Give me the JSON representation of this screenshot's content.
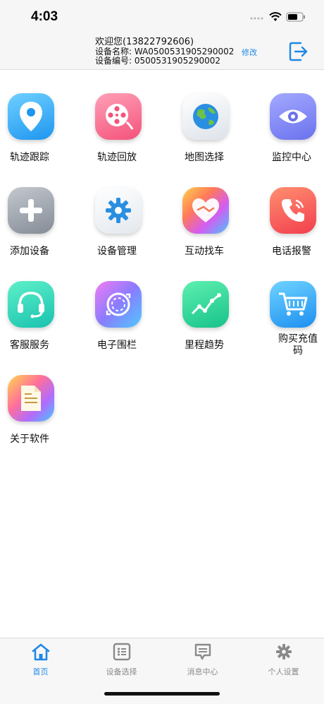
{
  "status": {
    "time": "4:03"
  },
  "header": {
    "welcome": "欢迎您(13822792606)",
    "device_name": "设备名称: WA0500531905290002",
    "device_no": "设备编号: 0500531905290002",
    "edit_label": "修改"
  },
  "tiles": [
    {
      "label": "轨迹跟踪",
      "icon": "location-pin-icon"
    },
    {
      "label": "轨迹回放",
      "icon": "film-reel-icon"
    },
    {
      "label": "地图选择",
      "icon": "globe-icon"
    },
    {
      "label": "监控中心",
      "icon": "eye-icon"
    },
    {
      "label": "添加设备",
      "icon": "plus-icon"
    },
    {
      "label": "设备管理",
      "icon": "gear-icon"
    },
    {
      "label": "互动找车",
      "icon": "handshake-heart-icon"
    },
    {
      "label": "电话报警",
      "icon": "phone-icon"
    },
    {
      "label": "客服服务",
      "icon": "headset-icon"
    },
    {
      "label": "电子围栏",
      "icon": "fence-ring-icon"
    },
    {
      "label": "里程趋势",
      "icon": "trend-line-icon"
    },
    {
      "label": "购买充值码",
      "icon": "shopping-cart-icon"
    },
    {
      "label": "关于软件",
      "icon": "document-icon"
    }
  ],
  "tabbar": {
    "items": [
      {
        "label": "首页",
        "icon": "home-icon",
        "active": true
      },
      {
        "label": "设备选择",
        "icon": "list-grid-icon",
        "active": false
      },
      {
        "label": "消息中心",
        "icon": "message-icon",
        "active": false
      },
      {
        "label": "个人设置",
        "icon": "gear-icon",
        "active": false
      }
    ]
  },
  "colors": {
    "accent": "#1e88e5",
    "header_bg": "#f6f6f6"
  }
}
